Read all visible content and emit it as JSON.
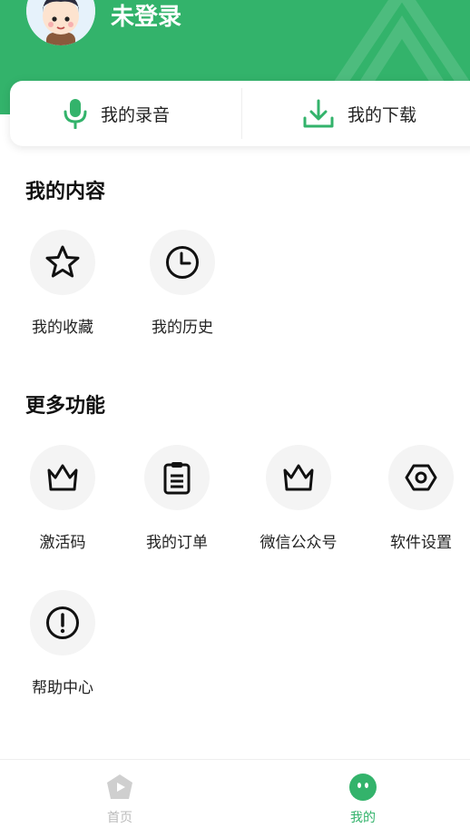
{
  "profile": {
    "username": "未登录"
  },
  "quick_actions": [
    {
      "label": "我的录音",
      "icon": "microphone-icon"
    },
    {
      "label": "我的下载",
      "icon": "download-icon"
    }
  ],
  "my_content": {
    "title": "我的内容",
    "items": [
      {
        "label": "我的收藏",
        "icon": "star-icon"
      },
      {
        "label": "我的历史",
        "icon": "clock-icon"
      }
    ]
  },
  "more_features": {
    "title": "更多功能",
    "items": [
      {
        "label": "激活码",
        "icon": "crown-icon"
      },
      {
        "label": "我的订单",
        "icon": "clipboard-icon"
      },
      {
        "label": "微信公众号",
        "icon": "crown-icon"
      },
      {
        "label": "软件设置",
        "icon": "hexagon-settings-icon"
      },
      {
        "label": "帮助中心",
        "icon": "exclamation-circle-icon"
      }
    ]
  },
  "tabbar": {
    "items": [
      {
        "label": "首页",
        "icon": "home-play-icon",
        "active": false
      },
      {
        "label": "我的",
        "icon": "profile-face-icon",
        "active": true
      }
    ]
  },
  "colors": {
    "brand": "#33b36b",
    "tab_inactive": "#bbbbbb",
    "icon_bg": "#f4f4f4"
  }
}
